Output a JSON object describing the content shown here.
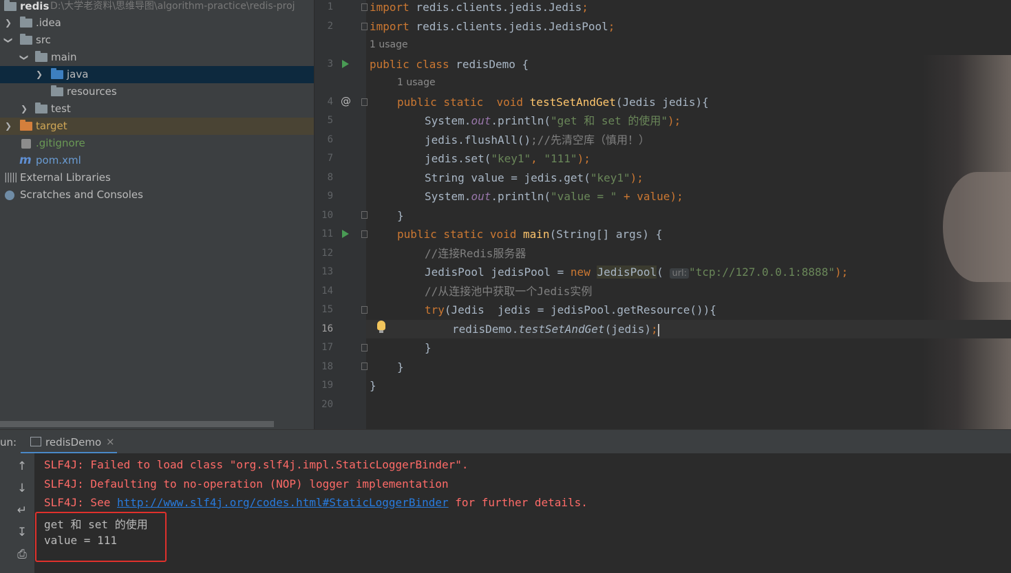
{
  "project": {
    "root_name": "redis",
    "root_path": "D:\\大学老资料\\思维导图\\algorithm-practice\\redis-proj",
    "items": [
      {
        "label": ".idea"
      },
      {
        "label": "src"
      },
      {
        "label": "main"
      },
      {
        "label": "java"
      },
      {
        "label": "resources"
      },
      {
        "label": "test"
      },
      {
        "label": "target"
      },
      {
        "label": ".gitignore"
      },
      {
        "label": "pom.xml"
      },
      {
        "label": "External Libraries"
      },
      {
        "label": "Scratches and Consoles"
      }
    ]
  },
  "editor": {
    "line_numbers": [
      "1",
      "2",
      "3",
      "4",
      "5",
      "6",
      "7",
      "8",
      "9",
      "10",
      "11",
      "12",
      "13",
      "14",
      "15",
      "16",
      "17",
      "18",
      "19",
      "20"
    ],
    "current_line": "16",
    "usage_hint": "1 usage",
    "code": {
      "l1_import": "import",
      "l1_rest": " redis.clients.jedis.Jedis",
      "l2_import": "import",
      "l2_rest": " redis.clients.jedis.JedisPool",
      "semi": ";",
      "l3_kw": "public class",
      "l3_rest": " redisDemo {",
      "l4_kw": "public static  void",
      "l4_fn": "testSetAndGet",
      "l4_rest": "(Jedis jedis){",
      "l5_a": "System.",
      "l5_out": "out",
      "l5_b": ".println(",
      "l5_str": "\"get 和 set 的使用\"",
      "l5_c": ");",
      "l6_a": "jedis.flushAll()",
      "l6_cm": ";//先清空库（慎用！）",
      "l7_a": "jedis.set(",
      "l7_s1": "\"key1\"",
      "l7_comma": ", ",
      "l7_s2": "\"111\"",
      "l7_b": ");",
      "l8_a": "String value = jedis.get(",
      "l8_s": "\"key1\"",
      "l8_b": ");",
      "l9_a": "System.",
      "l9_out": "out",
      "l9_b": ".println(",
      "l9_s": "\"value = \"",
      "l9_c": " + value);",
      "l10": "}",
      "l11_kw": "public static void",
      "l11_fn": "main",
      "l11_rest": "(String[] args) {",
      "l12_cm": "//连接Redis服务器",
      "l13_a": "JedisPool jedisPool = ",
      "l13_kw": "new",
      "l13_cls": "JedisPool",
      "l13_paren": "(",
      "l13_hint": "url:",
      "l13_s": "\"tcp://127.0.0.1:8888\"",
      "l13_b": ");",
      "l14_cm": "//从连接池中获取一个Jedis实例",
      "l15_kw": "try",
      "l15_rest": "(Jedis  jedis = jedisPool.getResource()){",
      "l16_a": "redisDemo.",
      "l16_fn": "testSetAndGet",
      "l16_b": "(jedis)",
      "l16_semi": ";",
      "l17": "}",
      "l18": "}",
      "l19": "}"
    }
  },
  "run": {
    "label": "un:",
    "tab_name": "redisDemo",
    "close": "×",
    "console": {
      "e1": "SLF4J: Failed to load class \"org.slf4j.impl.StaticLoggerBinder\".",
      "e2": "SLF4J: Defaulting to no-operation (NOP) logger implementation",
      "e3_a": "SLF4J: See ",
      "e3_link": "http://www.slf4j.org/codes.html#StaticLoggerBinder",
      "e3_b": " for further details.",
      "o1": "get 和 set 的使用",
      "o2": "value = 111"
    },
    "toolbar": [
      "arrow-up-icon",
      "arrow-down-icon",
      "soft-wrap-icon",
      "scroll-to-end-icon",
      "print-icon"
    ]
  },
  "colors": {
    "keyword": "#cc7832",
    "string": "#6a8759",
    "method": "#ffc66d",
    "error": "#ff6b68",
    "highlight_box": "#e0312c"
  }
}
